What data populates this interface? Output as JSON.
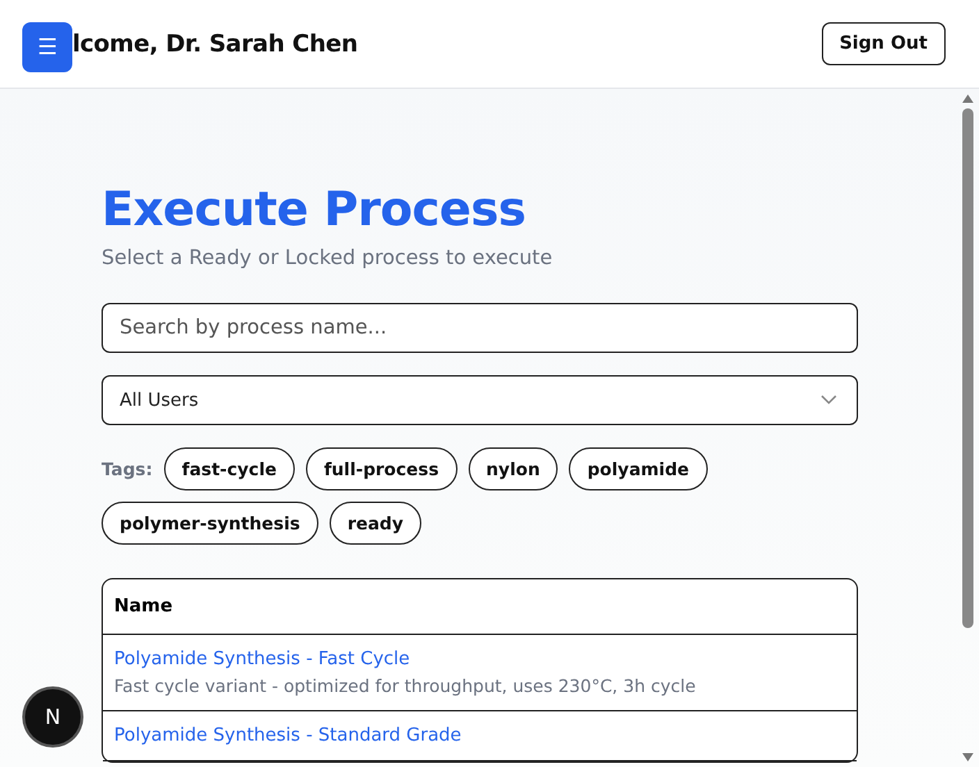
{
  "header": {
    "menu_button": "☰",
    "greeting": "lcome, Dr. Sarah Chen",
    "sign_out": "Sign Out"
  },
  "page": {
    "title": "Execute Process",
    "subtitle": "Select a Ready or Locked process to execute"
  },
  "search": {
    "placeholder": "Search by process name..."
  },
  "user_filter": {
    "value": "All Users"
  },
  "tags": {
    "label": "Tags:",
    "items": [
      {
        "label": "fast-cycle",
        "selected": false
      },
      {
        "label": "full-process",
        "selected": false
      },
      {
        "label": "nylon",
        "selected": false
      },
      {
        "label": "polyamide",
        "selected": false
      },
      {
        "label": "polymer-synthesis",
        "selected": false
      },
      {
        "label": "ready",
        "selected": false
      }
    ]
  },
  "table": {
    "columns": [
      "Name"
    ],
    "rows": [
      {
        "name": "Polyamide Synthesis - Fast Cycle",
        "description": "Fast cycle variant - optimized for throughput, uses 230°C, 3h cycle"
      },
      {
        "name": "Polyamide Synthesis - Standard Grade"
      }
    ]
  },
  "dev_badge": "N"
}
